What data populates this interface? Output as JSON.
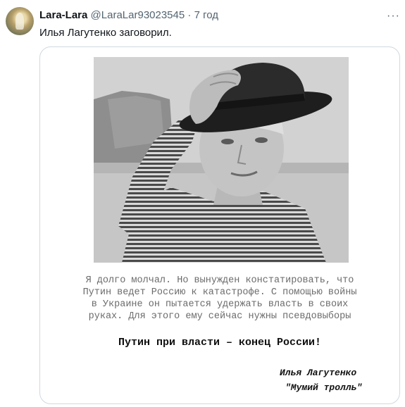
{
  "tweet": {
    "author_name": "Lara-Lara",
    "handle": "@LaraLar93023545",
    "separator": "·",
    "time": "7 год",
    "more": "···",
    "text": "Илья Лагутенко заговорил."
  },
  "media": {
    "letter_lines": [
      "Я долго молчал. Но вынужден констатировать, что",
      "Путин ведет Россию к катастрофе. С помощью войны",
      "в Украине он пытается удержать власть в своих",
      "руках. Для этого ему сейчас нужны псевдовыборы"
    ],
    "headline": "Путин при власти – конец России!",
    "signature_name": "Илья Лагутенко",
    "signature_band": "\"Мумий тролль\""
  }
}
